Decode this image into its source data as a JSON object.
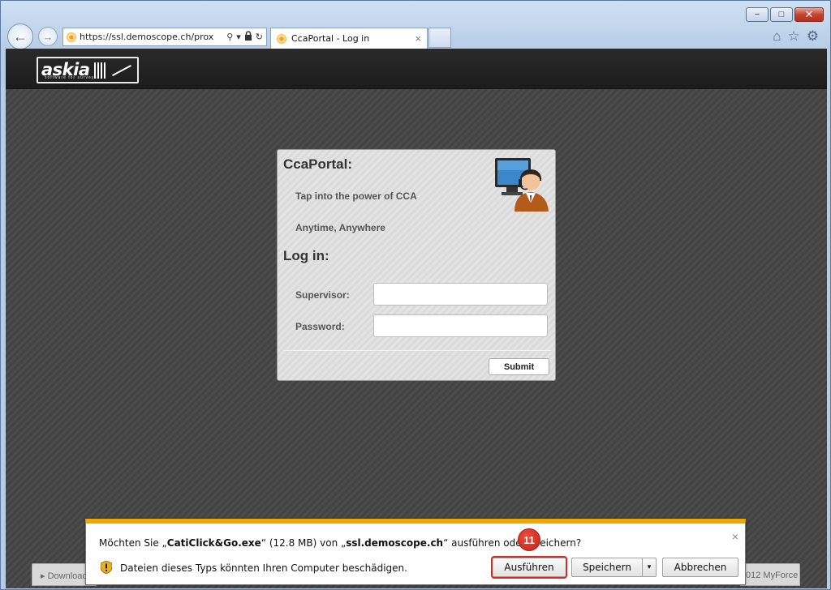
{
  "browser": {
    "address_url": "https://ssl.demoscope.ch/prox",
    "tab_title": "CcaPortal - Log in",
    "tab_close": "×",
    "window_controls": {
      "min": "−",
      "max": "□",
      "close": "✕"
    },
    "nav": {
      "back": "←",
      "forward": "→"
    },
    "toolbar": {
      "home": "⌂",
      "favorites": "☆",
      "tools": "⚙"
    },
    "address_icons": {
      "search": "⚲",
      "dropdown": "▾",
      "lock": "🔒",
      "refresh": "↻"
    }
  },
  "header": {
    "logo_text": "askia",
    "logo_tagline": "software for surveys"
  },
  "login": {
    "portal_title": "CcaPortal:",
    "tagline_1": "Tap into the power of CCA",
    "tagline_2": "Anytime, Anywhere",
    "login_title": "Log in:",
    "supervisor_label": "Supervisor:",
    "supervisor_value": "",
    "password_label": "Password:",
    "password_value": "",
    "submit_label": "Submit"
  },
  "footer": {
    "left_text": "▸ Download",
    "right_text": "012 MyForce"
  },
  "download_bar": {
    "question_prefix": "Möchten Sie „",
    "file_name": "CatiClick&Go.exe",
    "question_mid": "“ (12.8 MB) von „",
    "host": "ssl.demoscope.ch",
    "question_suffix": "“ ausführen oder speichern?",
    "warning": "Dateien dieses Typs könnten Ihren Computer beschädigen.",
    "run_label": "Ausführen",
    "save_label": "Speichern",
    "save_arrow": "▾",
    "cancel_label": "Abbrechen",
    "close": "×"
  },
  "annotation": {
    "step_number": "11"
  },
  "colors": {
    "notify_accent": "#f0a800",
    "highlight": "#d02a2a",
    "header_bg": "#1c1c1c"
  }
}
